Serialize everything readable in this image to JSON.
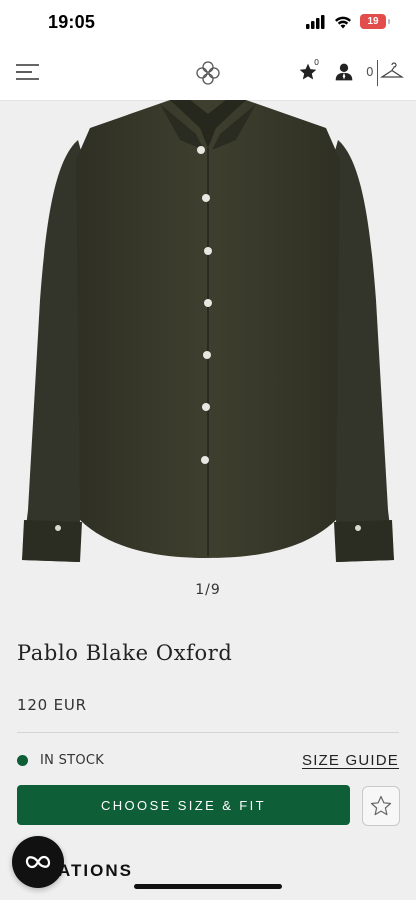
{
  "status_bar": {
    "time": "19:05",
    "battery_level": "19",
    "icons": [
      "signal-icon",
      "wifi-icon",
      "battery-icon"
    ]
  },
  "header": {
    "icons": [
      "menu-icon",
      "brand-logo-icon",
      "star-icon",
      "account-icon",
      "hanger-icon"
    ],
    "favorites_count": "0",
    "cart_count": "0"
  },
  "product": {
    "image": "dark olive oxford shirt",
    "image_color": "#3a3b2b",
    "pager": "1/9",
    "name": "Pablo Blake Oxford",
    "price": "120 EUR",
    "stock_status": "IN STOCK",
    "stock_color": "#0e5e38"
  },
  "actions": {
    "size_guide_label": "SIZE GUIDE",
    "cta_label": "CHOOSE SIZE & FIT",
    "cta_color": "#0e5e38",
    "wishlist_icon": "star-outline-icon"
  },
  "sections": {
    "heading_partial": "ATIONS"
  },
  "chat": {
    "icon": "chat-loop-icon"
  }
}
